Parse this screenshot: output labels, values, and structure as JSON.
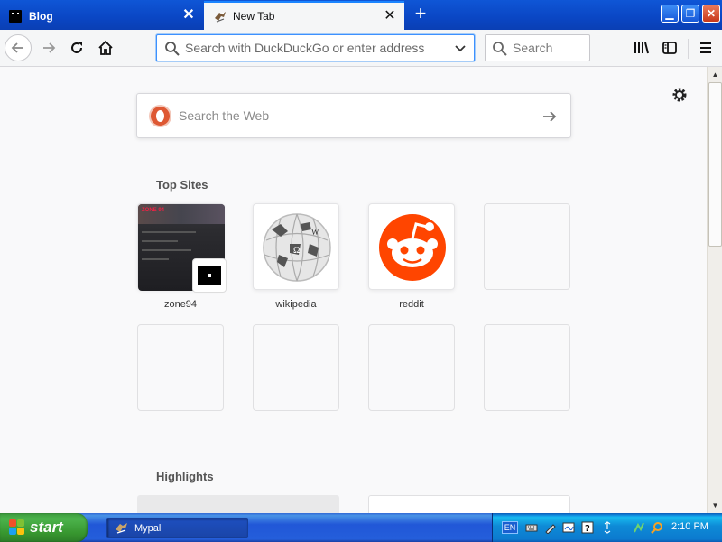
{
  "tabs": [
    {
      "title": "Blog",
      "favicon": "blog-icon"
    },
    {
      "title": "New Tab",
      "favicon": "mypal-icon",
      "active": true
    }
  ],
  "toolbar": {
    "url_placeholder": "Search with DuckDuckGo or enter address",
    "search_placeholder": "Search"
  },
  "web_search": {
    "placeholder": "Search the Web",
    "engine_icon": "duckduckgo-logo"
  },
  "top_sites": {
    "title": "Top Sites",
    "sites": [
      {
        "label": "zone94"
      },
      {
        "label": "wikipedia"
      },
      {
        "label": "reddit"
      },
      {
        "label": ""
      },
      {
        "label": ""
      },
      {
        "label": ""
      },
      {
        "label": ""
      },
      {
        "label": ""
      }
    ]
  },
  "highlights": {
    "title": "Highlights"
  },
  "taskbar": {
    "start_label": "start",
    "task_items": [
      {
        "label": "Mypal"
      }
    ],
    "language": "EN",
    "clock": "2:10 PM"
  },
  "colors": {
    "accent": "#0a60ff",
    "taskbar_blue": "#245edb",
    "start_green": "#37962f",
    "reddit_orange": "#ff4500",
    "duckduckgo_orange": "#de5833"
  }
}
